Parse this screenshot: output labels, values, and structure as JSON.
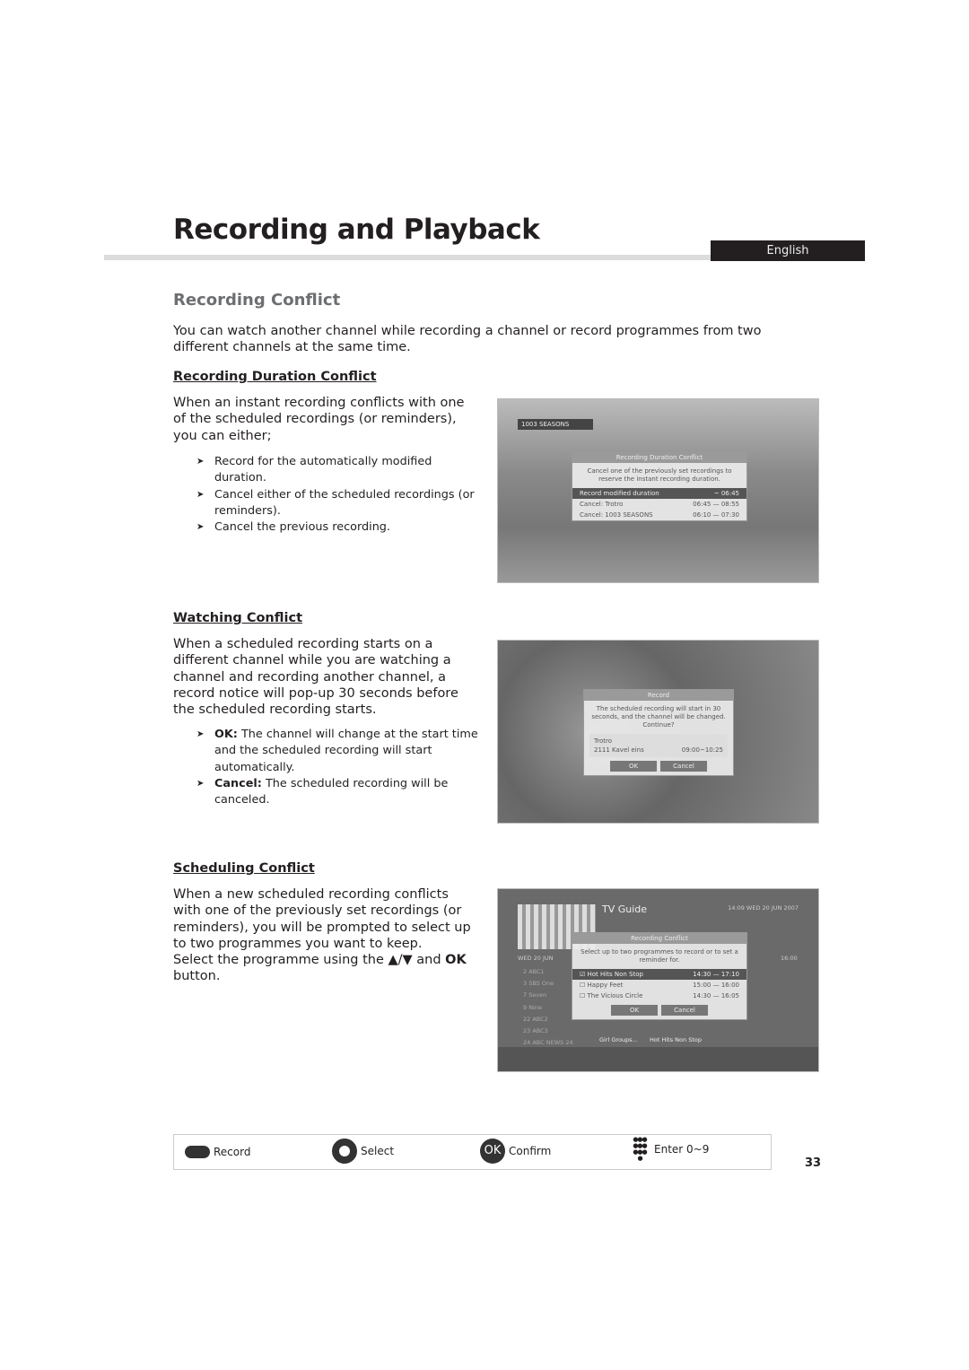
{
  "header": {
    "title": "Recording and Playback",
    "language": "English"
  },
  "section": {
    "title": "Recording Conflict",
    "intro": "You can watch another channel while recording a channel or record programmes from two different channels at the same time."
  },
  "duration": {
    "heading": "Recording Duration Conflict",
    "text": "When an instant recording conflicts with one of the scheduled recordings (or reminders), you can either;",
    "bullets": [
      "Record for the automatically modified duration.",
      "Cancel either of the scheduled recordings (or reminders).",
      "Cancel the previous recording."
    ],
    "screen": {
      "channel": "1003 SEASONS",
      "dialog_title": "Recording Duration Conflict",
      "message": "Cancel one of the previously set recordings to reserve the instant recording duration.",
      "rows": [
        {
          "label": "Record modified duration",
          "start": "",
          "end": "~ 06:45"
        },
        {
          "label": "Cancel: Trotro",
          "start": "06:45",
          "end": "08:55"
        },
        {
          "label": "Cancel: 1003 SEASONS",
          "start": "06:10",
          "end": "07:30"
        }
      ]
    }
  },
  "watching": {
    "heading": "Watching Conflict",
    "text": "When a scheduled recording starts on a different channel while you are watching a channel and recording another channel, a record notice will pop-up 30 seconds before the scheduled recording starts.",
    "bullets": [
      {
        "key": "OK:",
        "text": " The channel will change at the start time and the scheduled recording will start automatically."
      },
      {
        "key": "Cancel:",
        "text": " The scheduled recording will be canceled."
      }
    ],
    "screen": {
      "dialog_title": "Record",
      "message": "The scheduled recording will start in 30 seconds, and the channel will be changed. Continue?",
      "programme": "Trotro",
      "channel": "2111 Kavel eins",
      "time": "09:00~10:25",
      "ok": "OK",
      "cancel": "Cancel"
    }
  },
  "scheduling": {
    "heading": "Scheduling Conflict",
    "text": "When a new scheduled recording conflicts with one of the previously set recordings (or reminders), you will be prompted to select up to two programmes you want to keep.",
    "text2_pre": "Select the programme using the ▲/▼ and ",
    "text2_key": "OK",
    "text2_post": " button.",
    "screen": {
      "guide_title": "TV Guide",
      "clock": "14:09 WED 20 JUN 2007",
      "date": "WED 20 JUN",
      "time": "16:00",
      "dialog_title": "Recording Conflict",
      "message": "Select up to two programmes to record or to set a reminder for.",
      "rows": [
        {
          "label": "Hot Hits Non Stop",
          "start": "14:30",
          "end": "17:10",
          "checked": true
        },
        {
          "label": "Happy Feet",
          "start": "15:00",
          "end": "16:00",
          "checked": false
        },
        {
          "label": "The Vicious Circle",
          "start": "14:30",
          "end": "16:05",
          "checked": false
        }
      ],
      "channels": [
        "2 ABC1",
        "3 SBS One",
        "7 Seven",
        "9 Nine",
        "22 ABC2",
        "23 ABC3",
        "24 ABC NEWS 24"
      ],
      "bottom": [
        "Girl Groups...",
        "Hot Hits Non Stop"
      ],
      "ok": "OK",
      "cancel": "Cancel"
    }
  },
  "footer": {
    "items": [
      {
        "icon": "record-button-icon",
        "label": "Record"
      },
      {
        "icon": "navigation-pad-icon",
        "label": "Select"
      },
      {
        "icon": "ok-button-icon",
        "label": "Confirm",
        "glyph": "OK"
      },
      {
        "icon": "number-keypad-icon",
        "label": "Enter 0~9"
      }
    ],
    "page": "33"
  }
}
